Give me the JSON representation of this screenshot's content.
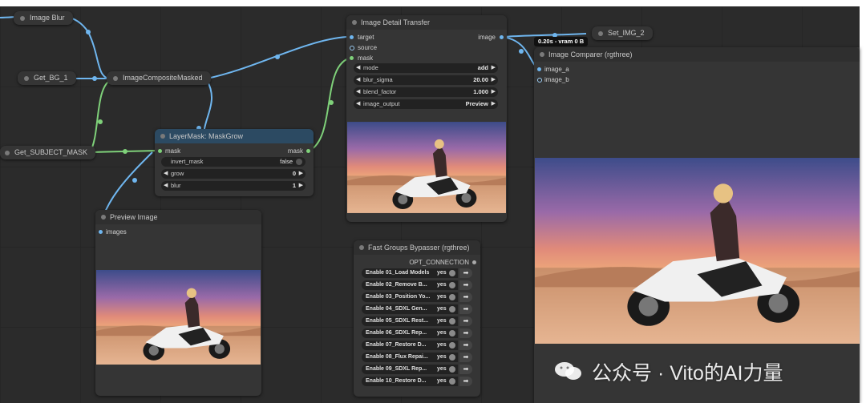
{
  "nodes": {
    "image_blur": {
      "title": "Image Blur"
    },
    "get_bg_1": {
      "title": "Get_BG_1"
    },
    "get_subject_mask": {
      "title": "Get_SUBJECT_MASK"
    },
    "image_composite_masked": {
      "title": "ImageCompositeMasked"
    },
    "set_img_2": {
      "title": "Set_IMG_2"
    },
    "image_detail_transfer": {
      "title": "Image Detail Transfer",
      "inputs": [
        "target",
        "source",
        "mask"
      ],
      "output": "image",
      "widgets": [
        {
          "label": "mode",
          "value": "add"
        },
        {
          "label": "blur_sigma",
          "value": "20.00"
        },
        {
          "label": "blend_factor",
          "value": "1.000"
        },
        {
          "label": "image_output",
          "value": "Preview"
        }
      ]
    },
    "layermask_maskgrow": {
      "title": "LayerMask: MaskGrow",
      "input": "mask",
      "output": "mask",
      "widgets": [
        {
          "label": "invert_mask",
          "value": "false"
        },
        {
          "label": "grow",
          "value": "0"
        },
        {
          "label": "blur",
          "value": "1"
        }
      ]
    },
    "preview_image": {
      "title": "Preview Image",
      "input": "images"
    },
    "image_comparer": {
      "title": "Image Comparer (rgthree)",
      "inputs": [
        "image_a",
        "image_b"
      ]
    },
    "fast_groups_bypasser": {
      "title": "Fast Groups Bypasser (rgthree)",
      "output": "OPT_CONNECTION",
      "rows": [
        {
          "label": "Enable 01_Load Models",
          "value": "yes"
        },
        {
          "label": "Enable 02_Remove B...",
          "value": "yes"
        },
        {
          "label": "Enable 03_Position Yo...",
          "value": "yes"
        },
        {
          "label": "Enable 04_SDXL Gen...",
          "value": "yes"
        },
        {
          "label": "Enable 05_SDXL Rest...",
          "value": "yes"
        },
        {
          "label": "Enable 06_SDXL Rep...",
          "value": "yes"
        },
        {
          "label": "Enable 07_Restore D...",
          "value": "yes"
        },
        {
          "label": "Enable 08_Flux Repai...",
          "value": "yes"
        },
        {
          "label": "Enable 09_SDXL Rep...",
          "value": "yes"
        },
        {
          "label": "Enable 10_Restore D...",
          "value": "yes"
        }
      ]
    }
  },
  "timing_badge": "0.20s - vram 0 B",
  "watermark": "公众号 · Vito的AI力量",
  "colors": {
    "canvas": "#2b2b2b",
    "node": "#353535",
    "image_wire": "#6fb6ef",
    "mask_wire": "#7fd17a",
    "maskgrow_title": "#2c4a62"
  }
}
